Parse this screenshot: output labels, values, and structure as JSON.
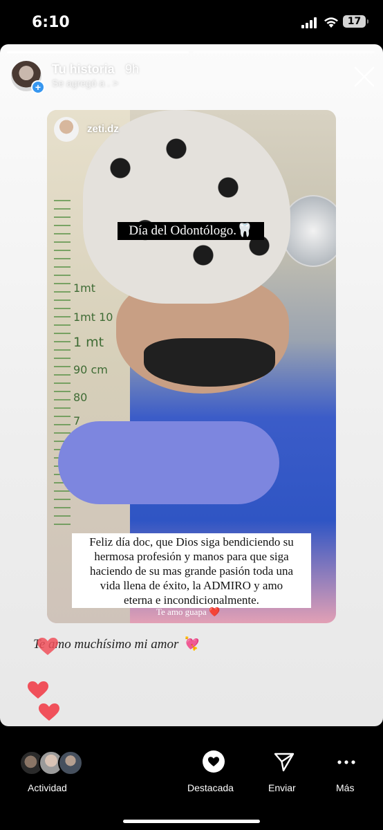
{
  "status_bar": {
    "time": "6:10",
    "battery": "17"
  },
  "story": {
    "owner": "Tu historia",
    "time_ago": "9h",
    "subtitle": "Se agregó a . >",
    "progress": [
      1.0,
      0.0
    ],
    "post": {
      "username": "zeti.dz",
      "title": "Día del Odontólogo.🦷",
      "wall_labels": [
        "1mt",
        "1mt 10",
        "1 mt",
        "90 cm",
        "80",
        "7"
      ],
      "message_lines": [
        "Feliz día doc, que Dios siga bendiciendo su",
        "hermosa profesión y manos para que siga",
        "haciendo de su mas grande pasión toda una",
        "vida llena de éxito, la ADMIRO y amo",
        "eterna e incondicionalmente."
      ],
      "note": "Te amo guapa ❤️"
    },
    "handwritten": "Te amo muchísimo mi amor 💘"
  },
  "bottom_bar": {
    "activity_label": "Actividad",
    "highlight_label": "Destacada",
    "send_label": "Enviar",
    "more_label": "Más"
  },
  "colors": {
    "heart": "#f0505a",
    "accent_blue": "#3797f0"
  }
}
